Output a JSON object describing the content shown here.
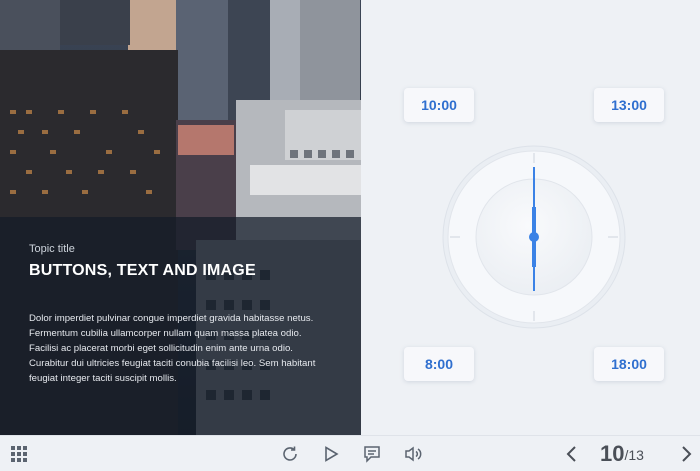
{
  "content": {
    "topic_title": "Topic title",
    "heading": "BUTTONS, TEXT AND IMAGE",
    "body": "Dolor imperdiet pulvinar congue imperdiet gravida habitasse netus. Fermentum cubilia ullamcorper nullam quam massa platea odio. Facilisi ac placerat morbi eget sollicitudin enim ante urna odio. Curabitur dui ultricies feugiat taciti conubia facilisi leo. Sem habitant feugiat integer taciti suscipit mollis."
  },
  "times": {
    "t1000": "10:00",
    "t1300": "13:00",
    "t800": "8:00",
    "t1800": "18:00"
  },
  "pagination": {
    "current": "10",
    "total": "/13"
  },
  "colors": {
    "accent": "#2f6fcf",
    "clock_hand": "#3b82e6",
    "toolbar_icon": "#5b6470"
  },
  "icons": {
    "menu": "grid-icon",
    "replay": "replay-icon",
    "play": "play-icon",
    "notes": "chat-icon",
    "audio": "speaker-icon",
    "prev": "chevron-left-icon",
    "next": "chevron-right-icon"
  }
}
